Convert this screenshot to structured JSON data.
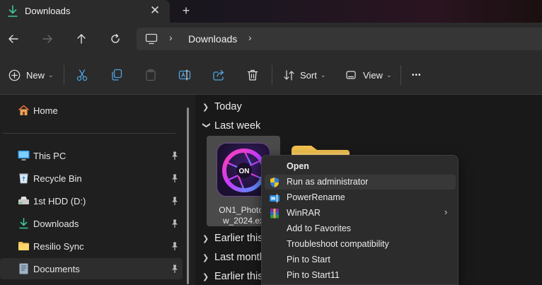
{
  "tab": {
    "title": "Downloads",
    "close_glyph": "✕",
    "new_tab_glyph": "+"
  },
  "address": {
    "breadcrumb": "Downloads",
    "separator": "›"
  },
  "commands": {
    "new_label": "New",
    "sort_label": "Sort",
    "view_label": "View",
    "caret": "⌄",
    "more_glyph": "•••"
  },
  "sidebar": {
    "items": [
      {
        "label": "Home",
        "icon": "home-icon"
      },
      {
        "label": "This PC",
        "icon": "pc-icon"
      },
      {
        "label": "Recycle Bin",
        "icon": "recycle-bin-icon"
      },
      {
        "label": "1st HDD (D:)",
        "icon": "drive-icon"
      },
      {
        "label": "Downloads",
        "icon": "download-icon"
      },
      {
        "label": "Resilio Sync",
        "icon": "folder-icon"
      },
      {
        "label": "Documents",
        "icon": "document-icon"
      }
    ]
  },
  "main": {
    "groups": [
      {
        "label": "Today",
        "expanded": false
      },
      {
        "label": "Last week",
        "expanded": true
      },
      {
        "label": "Earlier this",
        "expanded": false
      },
      {
        "label": "Last month",
        "expanded": false
      },
      {
        "label": "Earlier this",
        "expanded": false
      }
    ],
    "file": {
      "name_line1": "ON1_Photo_",
      "name_line2": "w_2024.ex",
      "logo_text": "ON"
    }
  },
  "context_menu": {
    "items": [
      {
        "label": "Open",
        "bold": true,
        "icon": ""
      },
      {
        "label": "Run as administrator",
        "icon": "uac-shield-icon"
      },
      {
        "label": "PowerRename",
        "icon": "powerrename-icon"
      },
      {
        "label": "WinRAR",
        "icon": "winrar-icon",
        "submenu": true
      },
      {
        "label": "Add to Favorites",
        "icon": ""
      },
      {
        "label": "Troubleshoot compatibility",
        "icon": ""
      },
      {
        "label": "Pin to Start",
        "icon": ""
      },
      {
        "label": "Pin to Start11",
        "icon": ""
      }
    ],
    "submenu_arrow": "›"
  },
  "colors": {
    "accent_green": "#3ec59a",
    "folder_yellow": "#f2c14e",
    "shield_blue": "#2f7fe0",
    "shield_yellow": "#f5c518"
  }
}
